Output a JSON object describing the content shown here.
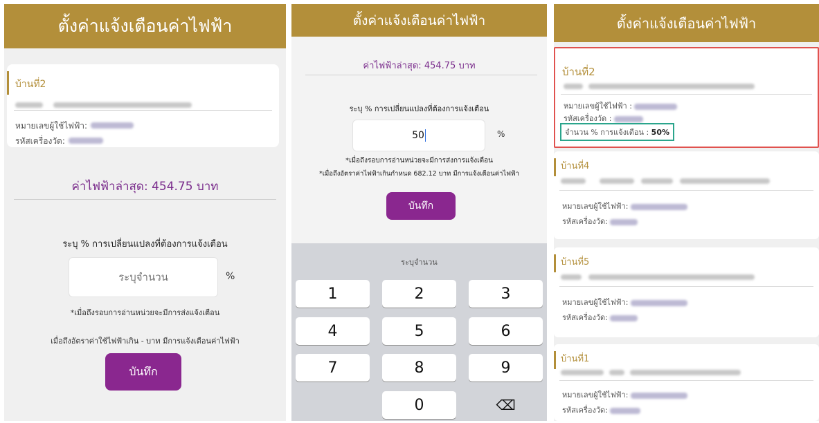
{
  "screen1": {
    "title": "ตั้งค่าแจ้งเตือนค่าไฟฟ้า",
    "house_name": "บ้านที่2",
    "meter_user_label": "หมายเลขผู้ใช้ไฟฟ้า:",
    "meter_code_label": "รหัสเครื่องวัด:",
    "latest_bill": "ค่าไฟฟ้าล่าสุด: 454.75 บาท",
    "instruction": "ระบุ % การเปลี่ยนแปลงที่ต้องการแจ้งเตือน",
    "input_placeholder": "ระบุจำนวน",
    "percent": "%",
    "note1": "*เมื่อถึงรอบการอ่านหน่วยจะมีการส่งแจ้งเตือน",
    "note2": "เมื่อถึงอัตราค่าใช้ไฟฟ้าเกิน - บาท มีการแจ้งเตือนค่าไฟฟ้า",
    "save_label": "บันทึก"
  },
  "screen2": {
    "title": "ตั้งค่าแจ้งเตือนค่าไฟฟ้า",
    "latest_bill": "ค่าไฟฟ้าล่าสุด: 454.75 บาท",
    "instruction": "ระบุ % การเปลี่ยนแปลงที่ต้องการแจ้งเตือน",
    "input_value": "50",
    "percent": "%",
    "note1": "*เมื่อถึงรอบการอ่านหน่วยจะมีการส่งการแจ้งเตือน",
    "note2": "*เมื่อถึงอัตราค่าไฟฟ้าเกินกำหนด 682.12 บาท มีการแจ้งเตือนค่าไฟฟ้า",
    "save_label": "บันทึก",
    "keypad_hint": "ระบุจำนวน",
    "keys": [
      "1",
      "2",
      "3",
      "4",
      "5",
      "6",
      "7",
      "8",
      "9",
      "",
      "0",
      "⌫"
    ]
  },
  "screen3": {
    "title": "ตั้งค่าแจ้งเตือนค่าไฟฟ้า",
    "meter_user_label": "หมายเลขผู้ใช้ไฟฟ้า :",
    "meter_code_label": "รหัสเครื่องวัด :",
    "alert_label": "จำนวน % การแจ้งเตือน :",
    "alert_value": "50%",
    "meter_user_label2": "หมายเลขผู้ใช้ไฟฟ้า:",
    "meter_code_label2": "รหัสเครื่องวัด:",
    "houses": [
      "บ้านที่2",
      "บ้านที่4",
      "บ้านที่5",
      "บ้านที่1"
    ]
  },
  "colors": {
    "header": "#b38f3a",
    "button": "#8a278f",
    "highlight_red": "#e0524f",
    "highlight_green": "#2aa58c"
  }
}
